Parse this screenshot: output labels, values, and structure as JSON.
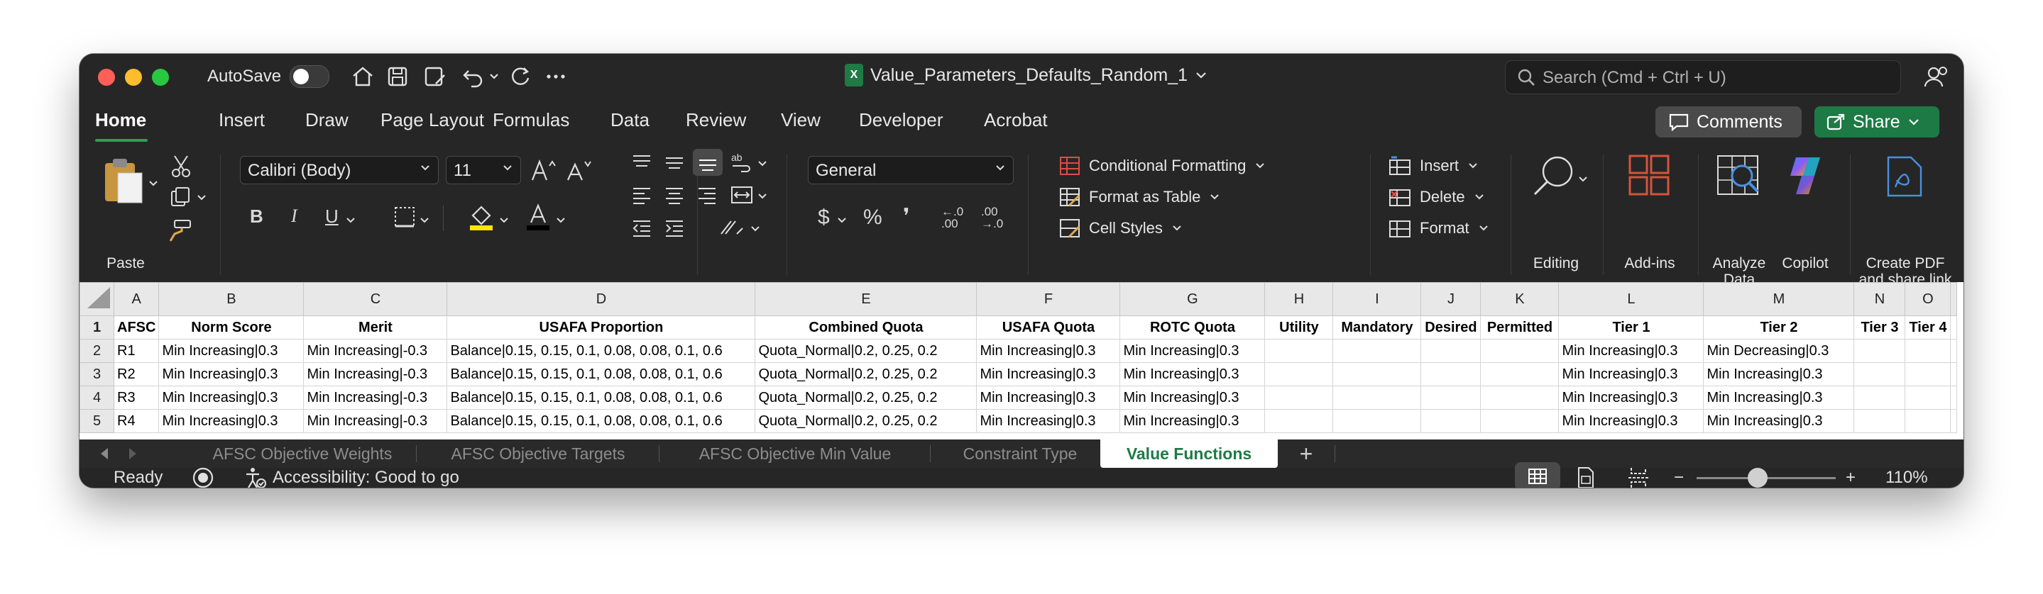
{
  "titlebar": {
    "autosave_label": "AutoSave",
    "document_title": "Value_Parameters_Defaults_Random_1",
    "search_placeholder": "Search (Cmd + Ctrl + U)"
  },
  "menu": {
    "tabs": [
      "Home",
      "Insert",
      "Draw",
      "Page Layout",
      "Formulas",
      "Data",
      "Review",
      "View",
      "Developer",
      "Acrobat"
    ],
    "active": "Home",
    "comments_label": "Comments",
    "share_label": "Share"
  },
  "ribbon": {
    "paste_label": "Paste",
    "font_name": "Calibri (Body)",
    "font_size": "11",
    "number_format": "General",
    "conditional_formatting": "Conditional Formatting",
    "format_as_table": "Format as Table",
    "cell_styles": "Cell Styles",
    "insert": "Insert",
    "delete": "Delete",
    "format": "Format",
    "editing": "Editing",
    "addins": "Add-ins",
    "analyze_data_1": "Analyze",
    "analyze_data_2": "Data",
    "copilot": "Copilot",
    "create_pdf_1": "Create PDF",
    "create_pdf_2": "and share link",
    "bold": "B",
    "italic": "I",
    "underline": "U",
    "percent": "%",
    "currency": "$",
    "comma": "❜",
    "dec_inc": "←.0 .00",
    "dec_dec": ".00 →.0"
  },
  "sheet": {
    "columns": [
      "A",
      "B",
      "C",
      "D",
      "E",
      "F",
      "G",
      "H",
      "I",
      "J",
      "K",
      "L",
      "M",
      "N",
      "O"
    ],
    "rows": [
      {
        "n": "1",
        "cells": [
          "AFSC",
          "Norm Score",
          "Merit",
          "USAFA Proportion",
          "Combined Quota",
          "USAFA Quota",
          "ROTC Quota",
          "Utility",
          "Mandatory",
          "Desired",
          "Permitted",
          "Tier 1",
          "Tier 2",
          "Tier 3",
          "Tier 4"
        ]
      },
      {
        "n": "2",
        "cells": [
          "R1",
          "Min Increasing|0.3",
          "Min Increasing|-0.3",
          "Balance|0.15, 0.15, 0.1, 0.08, 0.08, 0.1, 0.6",
          "Quota_Normal|0.2, 0.25, 0.2",
          "Min Increasing|0.3",
          "Min Increasing|0.3",
          "",
          "",
          "",
          "",
          "Min Increasing|0.3",
          "Min Decreasing|0.3",
          "",
          ""
        ]
      },
      {
        "n": "3",
        "cells": [
          "R2",
          "Min Increasing|0.3",
          "Min Increasing|-0.3",
          "Balance|0.15, 0.15, 0.1, 0.08, 0.08, 0.1, 0.6",
          "Quota_Normal|0.2, 0.25, 0.2",
          "Min Increasing|0.3",
          "Min Increasing|0.3",
          "",
          "",
          "",
          "",
          "Min Increasing|0.3",
          "Min Increasing|0.3",
          "",
          ""
        ]
      },
      {
        "n": "4",
        "cells": [
          "R3",
          "Min Increasing|0.3",
          "Min Increasing|-0.3",
          "Balance|0.15, 0.15, 0.1, 0.08, 0.08, 0.1, 0.6",
          "Quota_Normal|0.2, 0.25, 0.2",
          "Min Increasing|0.3",
          "Min Increasing|0.3",
          "",
          "",
          "",
          "",
          "Min Increasing|0.3",
          "Min Increasing|0.3",
          "",
          ""
        ]
      },
      {
        "n": "5",
        "cells": [
          "R4",
          "Min Increasing|0.3",
          "Min Increasing|-0.3",
          "Balance|0.15, 0.15, 0.1, 0.08, 0.08, 0.1, 0.6",
          "Quota_Normal|0.2, 0.25, 0.2",
          "Min Increasing|0.3",
          "Min Increasing|0.3",
          "",
          "",
          "",
          "",
          "Min Increasing|0.3",
          "Min Increasing|0.3",
          "",
          ""
        ]
      }
    ]
  },
  "sheet_tabs": {
    "tabs": [
      "AFSC Objective Weights",
      "AFSC Objective Targets",
      "AFSC Objective Min Value",
      "Constraint Type",
      "Value Functions"
    ],
    "active": "Value Functions",
    "add": "+"
  },
  "status": {
    "ready": "Ready",
    "accessibility": "Accessibility: Good to go",
    "zoom": "110%",
    "zoom_level_percent": 110
  },
  "colors": {
    "accent_green": "#1e7a45",
    "window_bg": "#242424"
  }
}
